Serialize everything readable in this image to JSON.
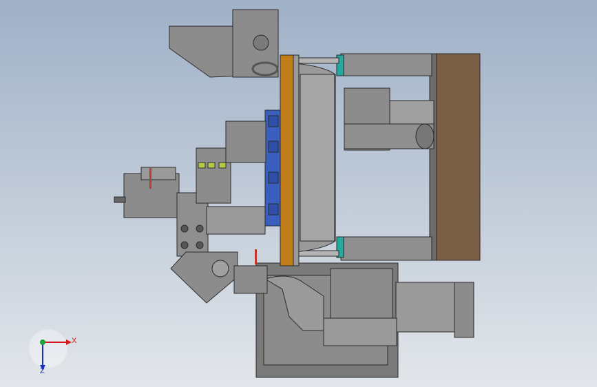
{
  "viewport": {
    "background_top": "#9fb0c7",
    "background_bottom": "#e2e6ea"
  },
  "model": {
    "colors": {
      "steel_dark": "#6f6f6f",
      "steel": "#8c8c8c",
      "steel_light": "#a9a9a9",
      "outline": "#2b2b2b",
      "orange_plate": "#c07d1a",
      "blue_parts": "#3b5fbf",
      "brown_plate": "#7a5e45",
      "teal_rings": "#23a9a0",
      "red_marks": "#c0392b",
      "yellow_green": "#b7c94a"
    }
  },
  "triad": {
    "x_label": "X",
    "z_label": "Z",
    "x_color": "#d11a1a",
    "z_color": "#1a2fbf",
    "origin_color": "#1aa63a"
  }
}
